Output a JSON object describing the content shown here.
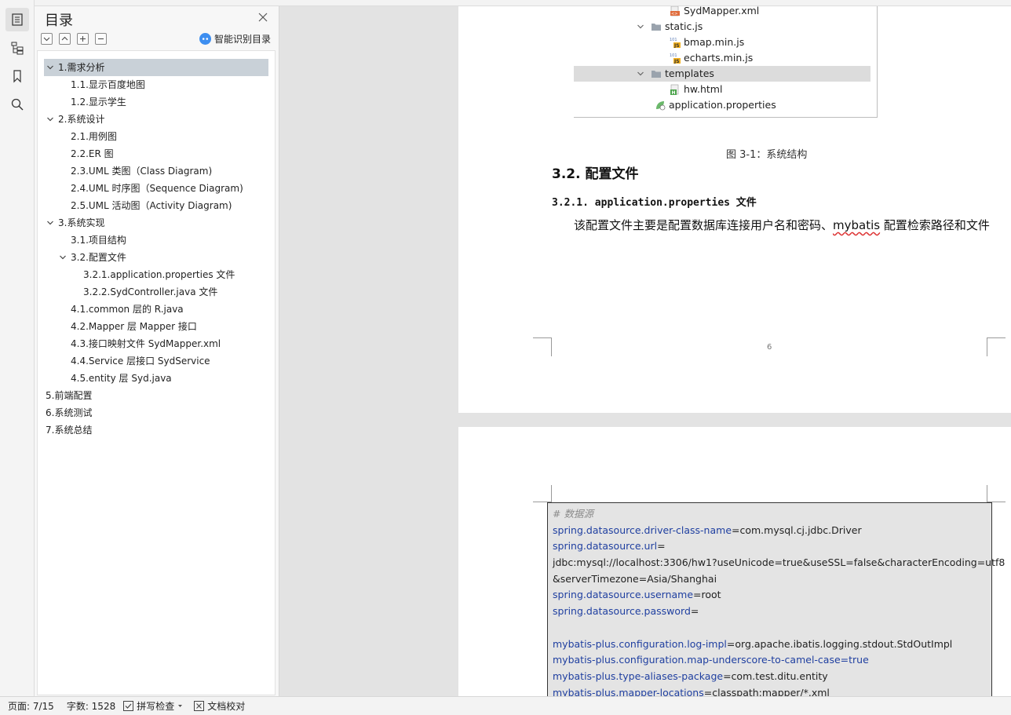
{
  "toc": {
    "title": "目录",
    "smart_label": "智能识别目录",
    "items": [
      {
        "text": "1.需求分析",
        "level": 0,
        "expanded": true,
        "selected": true
      },
      {
        "text": "1.1.显示百度地图",
        "level": 1
      },
      {
        "text": "1.2.显示学生",
        "level": 1
      },
      {
        "text": "2.系统设计",
        "level": 0,
        "expanded": true
      },
      {
        "text": "2.1.用例图",
        "level": 1
      },
      {
        "text": "2.2.ER 图",
        "level": 1
      },
      {
        "text": "2.3.UML 类图（Class Diagram)",
        "level": 1
      },
      {
        "text": "2.4.UML 时序图（Sequence Diagram)",
        "level": 1
      },
      {
        "text": "2.5.UML 活动图（Activity Diagram)",
        "level": 1
      },
      {
        "text": "3.系统实现",
        "level": 0,
        "expanded": true
      },
      {
        "text": "3.1.项目结构",
        "level": 1
      },
      {
        "text": "3.2.配置文件",
        "level": 1,
        "expanded": true
      },
      {
        "text": "3.2.1.application.properties 文件",
        "level": 2
      },
      {
        "text": "3.2.2.SydController.java 文件",
        "level": 2
      },
      {
        "text": "4.1.common 层的 R.java",
        "level": 1
      },
      {
        "text": "4.2.Mapper 层 Mapper 接口",
        "level": 1
      },
      {
        "text": "4.3.接口映射文件 SydMapper.xml",
        "level": 1
      },
      {
        "text": "4.4.Service 层接口 SydService",
        "level": 1
      },
      {
        "text": "4.5.entity 层 Syd.java",
        "level": 1
      },
      {
        "text": "5.前端配置",
        "level": 0
      },
      {
        "text": "6.系统测试",
        "level": 0
      },
      {
        "text": "7.系统总结",
        "level": 0
      }
    ]
  },
  "tree": {
    "rows": [
      {
        "text": "SydMapper.xml",
        "icon": "xml-file-icon"
      },
      {
        "text": "static.js",
        "icon": "folder-icon"
      },
      {
        "text": "bmap.min.js",
        "icon": "js-file-icon"
      },
      {
        "text": "echarts.min.js",
        "icon": "js-file-icon"
      },
      {
        "text": "templates",
        "icon": "folder-icon"
      },
      {
        "text": "hw.html",
        "icon": "html-file-icon"
      },
      {
        "text": "application.properties",
        "icon": "properties-file-icon"
      }
    ]
  },
  "doc": {
    "caption": "图 3-1：系统结构",
    "h2": "3.2. 配置文件",
    "h3_num": "3.2.1.",
    "h3_text": "application.properties 文件",
    "para_a": "该配置文件主要是配置数据库连接用户名和密码、",
    "para_word": "mybatis",
    "para_b": " 配置检索路径和文件",
    "page_number": "6"
  },
  "code": {
    "comment": "# 数据源",
    "lines": [
      {
        "k": "spring.datasource.driver-class-name",
        "v": "=com.mysql.cj.jdbc.Driver"
      },
      {
        "k": "spring.datasource.url",
        "v": "="
      },
      {
        "k": "",
        "v": "jdbc:mysql://localhost:3306/hw1?useUnicode=true&useSSL=false&characterEncoding=utf8"
      },
      {
        "k": "",
        "v": "&serverTimezone=Asia/Shanghai"
      },
      {
        "k": "spring.datasource.username",
        "v": "=root"
      },
      {
        "k": "spring.datasource.password",
        "v": "="
      },
      {
        "k": "",
        "v": ""
      },
      {
        "k": "mybatis-plus.configuration.log-impl",
        "v": "=org.apache.ibatis.logging.stdout.StdOutImpl"
      },
      {
        "k": "mybatis-plus.configuration.map-underscore-to-camel-case=true",
        "v": ""
      },
      {
        "k": "mybatis-plus.type-aliases-package",
        "v": "=com.test.ditu.entity"
      },
      {
        "k": "mybatis-plus.mapper-locations",
        "v": "=classpath:mapper/*.xml"
      }
    ]
  },
  "status": {
    "page": "页面: 7/15",
    "words": "字数: 1528",
    "spell": "拼写检查",
    "proof": "文档校对"
  },
  "colors": {
    "accent": "#3d8ef0",
    "selection": "#c9d1d8",
    "code_key": "#1f3fa0"
  }
}
